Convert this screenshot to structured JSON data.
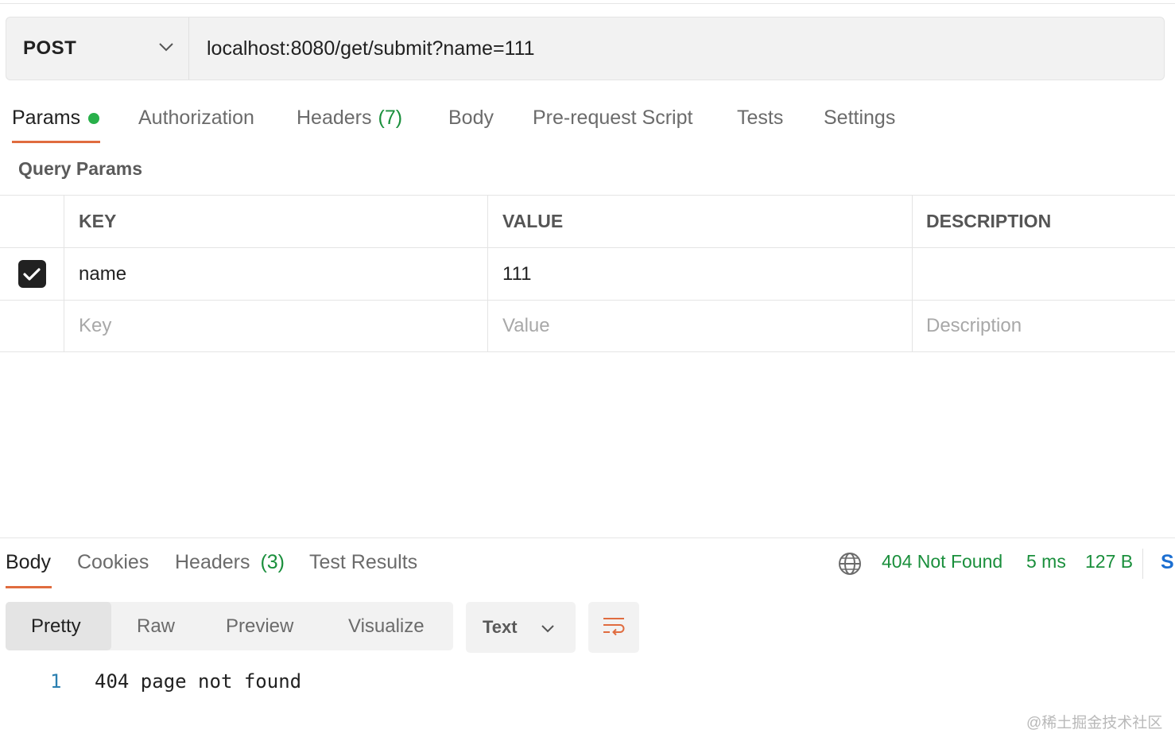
{
  "request": {
    "method": "POST",
    "url": "localhost:8080/get/submit?name=111"
  },
  "request_tabs": [
    {
      "label": "Params",
      "active": true
    },
    {
      "label": "Authorization"
    },
    {
      "label": "Headers",
      "count": "(7)"
    },
    {
      "label": "Body"
    },
    {
      "label": "Pre-request Script"
    },
    {
      "label": "Tests"
    },
    {
      "label": "Settings"
    }
  ],
  "query_params": {
    "title": "Query Params",
    "columns": [
      "KEY",
      "VALUE",
      "DESCRIPTION"
    ],
    "rows": [
      {
        "checked": true,
        "key": "name",
        "value": "111",
        "description": ""
      }
    ],
    "placeholders": {
      "key": "Key",
      "value": "Value",
      "description": "Description"
    }
  },
  "response_tabs": [
    {
      "label": "Body",
      "active": true
    },
    {
      "label": "Cookies"
    },
    {
      "label": "Headers",
      "count": "(3)"
    },
    {
      "label": "Test Results"
    }
  ],
  "response_status": {
    "status": "404 Not Found",
    "time": "5 ms",
    "size": "127 B",
    "save_truncated": "S",
    "status_color": "#1a8f3c"
  },
  "view_modes": [
    "Pretty",
    "Raw",
    "Preview",
    "Visualize"
  ],
  "active_view_mode": "Pretty",
  "format": "Text",
  "body_lines": [
    {
      "number": "1",
      "text": "404 page not found"
    }
  ],
  "watermark": "@稀土掘金技术社区",
  "colors": {
    "accent": "#e06c3f",
    "success": "#1a8f3c",
    "link": "#1c6fd1"
  }
}
